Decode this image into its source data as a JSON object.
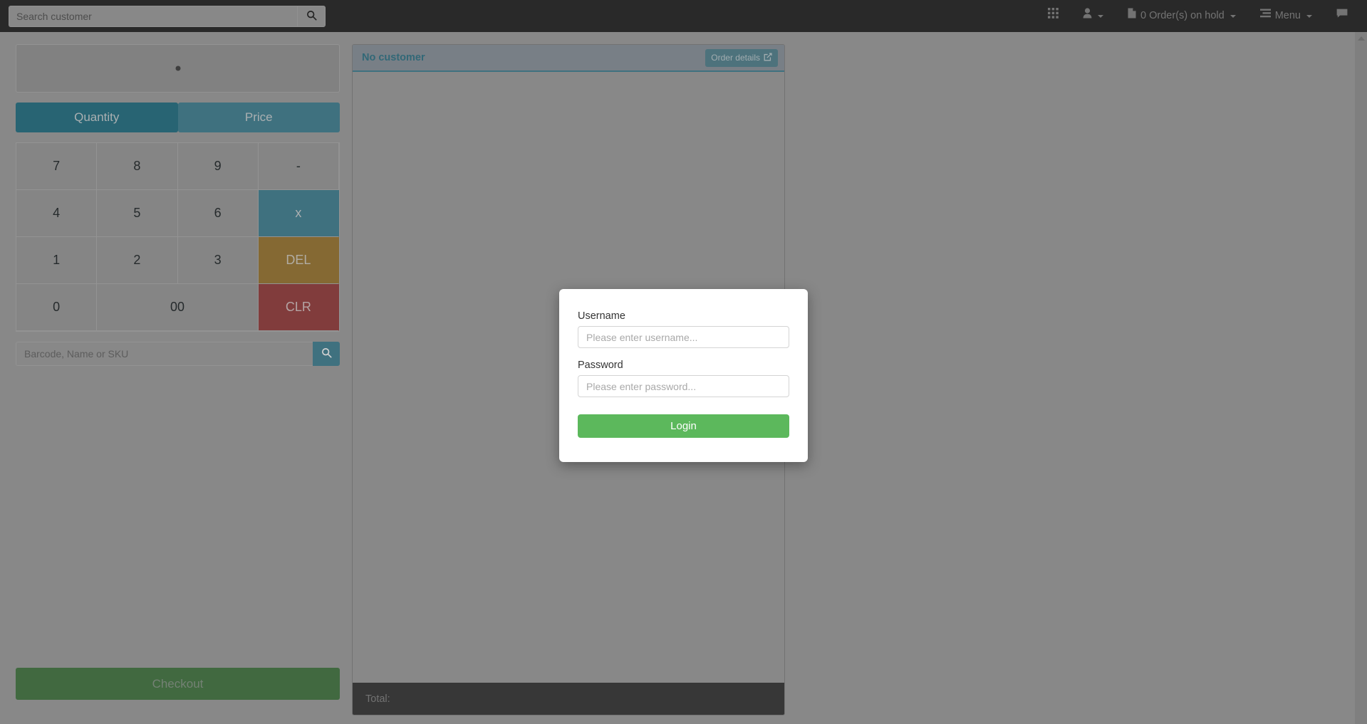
{
  "navbar": {
    "search_placeholder": "Search customer",
    "search_value": "",
    "search_icon": "search-icon",
    "items": [
      {
        "icon": "grid-apps-icon",
        "label": ""
      },
      {
        "icon": "user-icon",
        "label": ""
      },
      {
        "icon": "file-icon",
        "label": "0 Order(s) on hold"
      },
      {
        "icon": "list-menu-icon",
        "label": "Menu"
      },
      {
        "icon": "comment-icon",
        "label": ""
      }
    ]
  },
  "numpad": {
    "display_value": "",
    "display_caret": "·",
    "tabs": [
      {
        "label": "Quantity",
        "active": true
      },
      {
        "label": "Price",
        "active": false
      }
    ],
    "keys": [
      {
        "label": "7",
        "style": "num"
      },
      {
        "label": "8",
        "style": "num"
      },
      {
        "label": "9",
        "style": "num"
      },
      {
        "label": "-",
        "style": "num"
      },
      {
        "label": "4",
        "style": "num"
      },
      {
        "label": "5",
        "style": "num"
      },
      {
        "label": "6",
        "style": "num"
      },
      {
        "label": "x",
        "style": "multiply"
      },
      {
        "label": "1",
        "style": "num"
      },
      {
        "label": "2",
        "style": "num"
      },
      {
        "label": "3",
        "style": "num"
      },
      {
        "label": "DEL",
        "style": "delete"
      },
      {
        "label": "0",
        "style": "num"
      },
      {
        "label": "00",
        "style": "num-wide"
      },
      {
        "label": "CLR",
        "style": "clear"
      }
    ]
  },
  "barcode": {
    "placeholder": "Barcode, Name or SKU",
    "value": "",
    "search_icon": "search-icon"
  },
  "checkout": {
    "label": "Checkout"
  },
  "order": {
    "customer_title": "No customer",
    "details_label": "Order details",
    "details_icon": "edit-square-icon",
    "total_label": "Total:",
    "total_value": ""
  },
  "login_modal": {
    "username_label": "Username",
    "username_placeholder": "Please enter username...",
    "username_value": "",
    "password_label": "Password",
    "password_placeholder": "Please enter password...",
    "password_value": "",
    "submit_label": "Login"
  },
  "colors": {
    "navbar_bg": "#333333",
    "page_bg": "#a6a6a6",
    "teal_active": "#317b8d",
    "teal": "#4e8a9b",
    "gold": "#a3813f",
    "red": "#9e4a4a",
    "green_checkout": "#50804f",
    "green_login": "#5cb85c",
    "total_bar": "#444444"
  }
}
